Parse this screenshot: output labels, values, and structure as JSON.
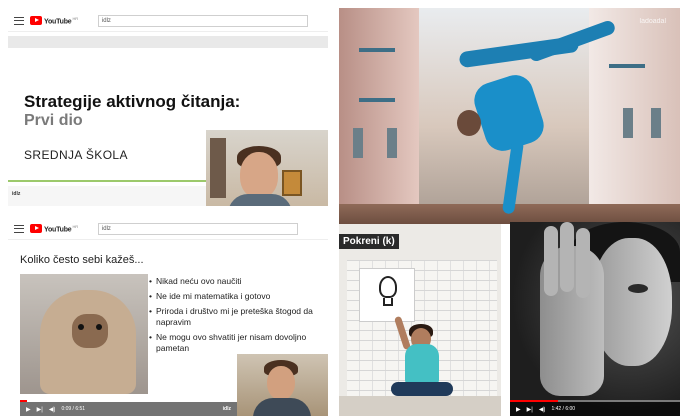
{
  "youtube": {
    "logo_text": "YouTube",
    "logo_region": "HR",
    "search_value": "idlz"
  },
  "slide1": {
    "title": "Strategije aktivnog čitanja:",
    "subtitle": "Prvi dio",
    "school": "SREDNJA ŠKOLA",
    "footer_brand": "idlz"
  },
  "slide2": {
    "question": "Koliko često sebi kažeš...",
    "bullets": [
      "Nikad neću ovo naučiti",
      "Ne ide mi matematika i gotovo",
      "Priroda i društvo mi je preteška štogod da napravim",
      "Ne mogu ovo shvatiti jer nisam dovoljno pametan"
    ],
    "time": "0:09 / 6:51",
    "progress": 0.03,
    "footer_brand": "idlz"
  },
  "breakdance": {
    "watermark": "ladoadal"
  },
  "lightbulb": {
    "label": "Pokreni (k)"
  },
  "eye_video": {
    "time": "1:42 / 6:00",
    "progress": 0.28
  },
  "icons": [
    "menu-icon",
    "youtube-play-icon",
    "play-icon",
    "next-icon",
    "volume-icon",
    "settings-icon",
    "fullscreen-icon"
  ]
}
